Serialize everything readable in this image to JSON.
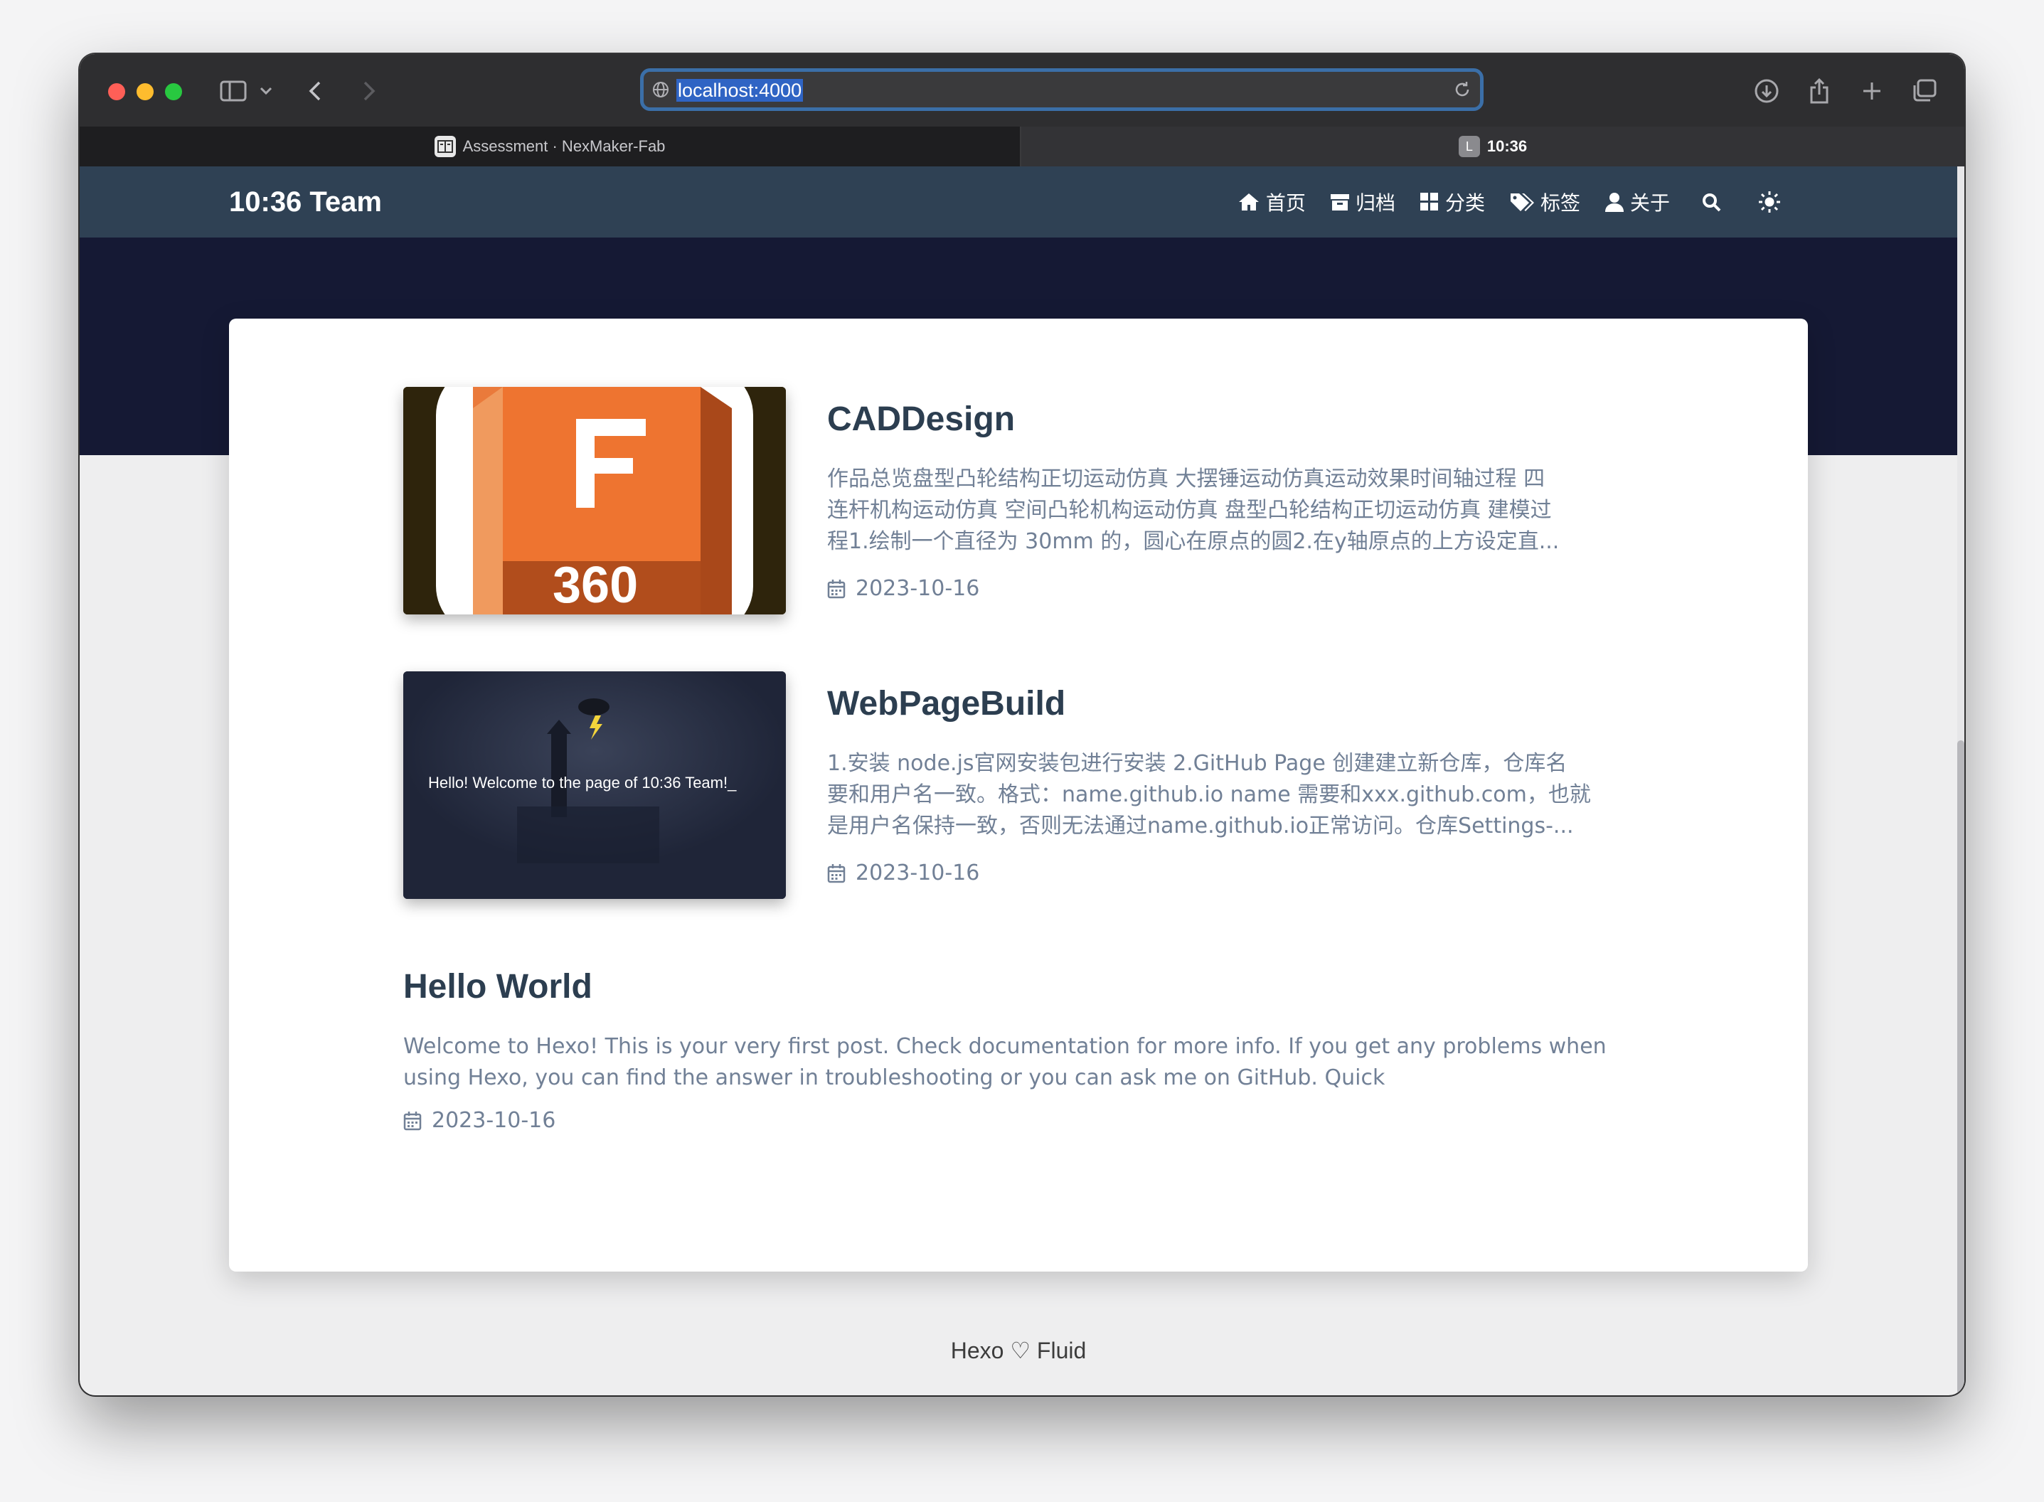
{
  "browser": {
    "url": "localhost:4000",
    "tabs": [
      {
        "label": "Assessment · NexMaker-Fab",
        "active": false
      },
      {
        "label": "10:36",
        "badge": "L",
        "active": true
      }
    ]
  },
  "site": {
    "brand": "10:36 Team",
    "nav": [
      {
        "label": "首页",
        "icon": "home-icon"
      },
      {
        "label": "归档",
        "icon": "archive-icon"
      },
      {
        "label": "分类",
        "icon": "categories-icon"
      },
      {
        "label": "标签",
        "icon": "tags-icon"
      },
      {
        "label": "关于",
        "icon": "user-icon"
      }
    ]
  },
  "posts": [
    {
      "title": "CADDesign",
      "excerpt_lines": [
        "作品总览盘型凸轮结构正切运动仿真 大摆锤运动仿真运动效果时间轴过程 四",
        "连杆机构运动仿真 空间凸轮机构运动仿真 盘型凸轮结构正切运动仿真 建模过",
        "程1.绘制一个直径为 30mm 的，圆心在原点的圆2.在y轴原点的上方设定直..."
      ],
      "date": "2023-10-16",
      "thumb_text": "360",
      "thumb_letter": "F"
    },
    {
      "title": "WebPageBuild",
      "excerpt_lines": [
        "1.安装 node.js官网安装包进行安装 2.GitHub Page 创建建立新仓库，仓库名",
        "要和用户名一致。格式：name.github.io name 需要和xxx.github.com，也就",
        "是用户名保持一致，否则无法通过name.github.io正常访问。仓库Settings-..."
      ],
      "date": "2023-10-16",
      "thumb_text": "Hello! Welcome to the page of 10:36 Team!_"
    },
    {
      "title": "Hello World",
      "excerpt_lines": [
        "Welcome to Hexo! This is your very first post. Check documentation for more info. If you get any problems when",
        "using Hexo, you can find the answer in troubleshooting or you can ask me on GitHub. Quick"
      ],
      "date": "2023-10-16"
    }
  ],
  "footer": {
    "left": "Hexo",
    "heart": "♡",
    "right": "Fluid"
  }
}
